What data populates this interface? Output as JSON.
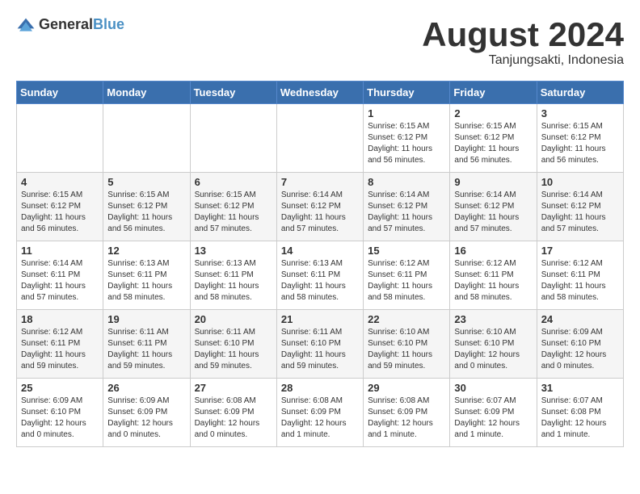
{
  "header": {
    "logo_general": "General",
    "logo_blue": "Blue",
    "month_year": "August 2024",
    "location": "Tanjungsakti, Indonesia"
  },
  "days_of_week": [
    "Sunday",
    "Monday",
    "Tuesday",
    "Wednesday",
    "Thursday",
    "Friday",
    "Saturday"
  ],
  "weeks": [
    [
      {
        "day": "",
        "info": ""
      },
      {
        "day": "",
        "info": ""
      },
      {
        "day": "",
        "info": ""
      },
      {
        "day": "",
        "info": ""
      },
      {
        "day": "1",
        "info": "Sunrise: 6:15 AM\nSunset: 6:12 PM\nDaylight: 11 hours\nand 56 minutes."
      },
      {
        "day": "2",
        "info": "Sunrise: 6:15 AM\nSunset: 6:12 PM\nDaylight: 11 hours\nand 56 minutes."
      },
      {
        "day": "3",
        "info": "Sunrise: 6:15 AM\nSunset: 6:12 PM\nDaylight: 11 hours\nand 56 minutes."
      }
    ],
    [
      {
        "day": "4",
        "info": "Sunrise: 6:15 AM\nSunset: 6:12 PM\nDaylight: 11 hours\nand 56 minutes."
      },
      {
        "day": "5",
        "info": "Sunrise: 6:15 AM\nSunset: 6:12 PM\nDaylight: 11 hours\nand 56 minutes."
      },
      {
        "day": "6",
        "info": "Sunrise: 6:15 AM\nSunset: 6:12 PM\nDaylight: 11 hours\nand 57 minutes."
      },
      {
        "day": "7",
        "info": "Sunrise: 6:14 AM\nSunset: 6:12 PM\nDaylight: 11 hours\nand 57 minutes."
      },
      {
        "day": "8",
        "info": "Sunrise: 6:14 AM\nSunset: 6:12 PM\nDaylight: 11 hours\nand 57 minutes."
      },
      {
        "day": "9",
        "info": "Sunrise: 6:14 AM\nSunset: 6:12 PM\nDaylight: 11 hours\nand 57 minutes."
      },
      {
        "day": "10",
        "info": "Sunrise: 6:14 AM\nSunset: 6:12 PM\nDaylight: 11 hours\nand 57 minutes."
      }
    ],
    [
      {
        "day": "11",
        "info": "Sunrise: 6:14 AM\nSunset: 6:11 PM\nDaylight: 11 hours\nand 57 minutes."
      },
      {
        "day": "12",
        "info": "Sunrise: 6:13 AM\nSunset: 6:11 PM\nDaylight: 11 hours\nand 58 minutes."
      },
      {
        "day": "13",
        "info": "Sunrise: 6:13 AM\nSunset: 6:11 PM\nDaylight: 11 hours\nand 58 minutes."
      },
      {
        "day": "14",
        "info": "Sunrise: 6:13 AM\nSunset: 6:11 PM\nDaylight: 11 hours\nand 58 minutes."
      },
      {
        "day": "15",
        "info": "Sunrise: 6:12 AM\nSunset: 6:11 PM\nDaylight: 11 hours\nand 58 minutes."
      },
      {
        "day": "16",
        "info": "Sunrise: 6:12 AM\nSunset: 6:11 PM\nDaylight: 11 hours\nand 58 minutes."
      },
      {
        "day": "17",
        "info": "Sunrise: 6:12 AM\nSunset: 6:11 PM\nDaylight: 11 hours\nand 58 minutes."
      }
    ],
    [
      {
        "day": "18",
        "info": "Sunrise: 6:12 AM\nSunset: 6:11 PM\nDaylight: 11 hours\nand 59 minutes."
      },
      {
        "day": "19",
        "info": "Sunrise: 6:11 AM\nSunset: 6:11 PM\nDaylight: 11 hours\nand 59 minutes."
      },
      {
        "day": "20",
        "info": "Sunrise: 6:11 AM\nSunset: 6:10 PM\nDaylight: 11 hours\nand 59 minutes."
      },
      {
        "day": "21",
        "info": "Sunrise: 6:11 AM\nSunset: 6:10 PM\nDaylight: 11 hours\nand 59 minutes."
      },
      {
        "day": "22",
        "info": "Sunrise: 6:10 AM\nSunset: 6:10 PM\nDaylight: 11 hours\nand 59 minutes."
      },
      {
        "day": "23",
        "info": "Sunrise: 6:10 AM\nSunset: 6:10 PM\nDaylight: 12 hours\nand 0 minutes."
      },
      {
        "day": "24",
        "info": "Sunrise: 6:09 AM\nSunset: 6:10 PM\nDaylight: 12 hours\nand 0 minutes."
      }
    ],
    [
      {
        "day": "25",
        "info": "Sunrise: 6:09 AM\nSunset: 6:10 PM\nDaylight: 12 hours\nand 0 minutes."
      },
      {
        "day": "26",
        "info": "Sunrise: 6:09 AM\nSunset: 6:09 PM\nDaylight: 12 hours\nand 0 minutes."
      },
      {
        "day": "27",
        "info": "Sunrise: 6:08 AM\nSunset: 6:09 PM\nDaylight: 12 hours\nand 0 minutes."
      },
      {
        "day": "28",
        "info": "Sunrise: 6:08 AM\nSunset: 6:09 PM\nDaylight: 12 hours\nand 1 minute."
      },
      {
        "day": "29",
        "info": "Sunrise: 6:08 AM\nSunset: 6:09 PM\nDaylight: 12 hours\nand 1 minute."
      },
      {
        "day": "30",
        "info": "Sunrise: 6:07 AM\nSunset: 6:09 PM\nDaylight: 12 hours\nand 1 minute."
      },
      {
        "day": "31",
        "info": "Sunrise: 6:07 AM\nSunset: 6:08 PM\nDaylight: 12 hours\nand 1 minute."
      }
    ]
  ]
}
